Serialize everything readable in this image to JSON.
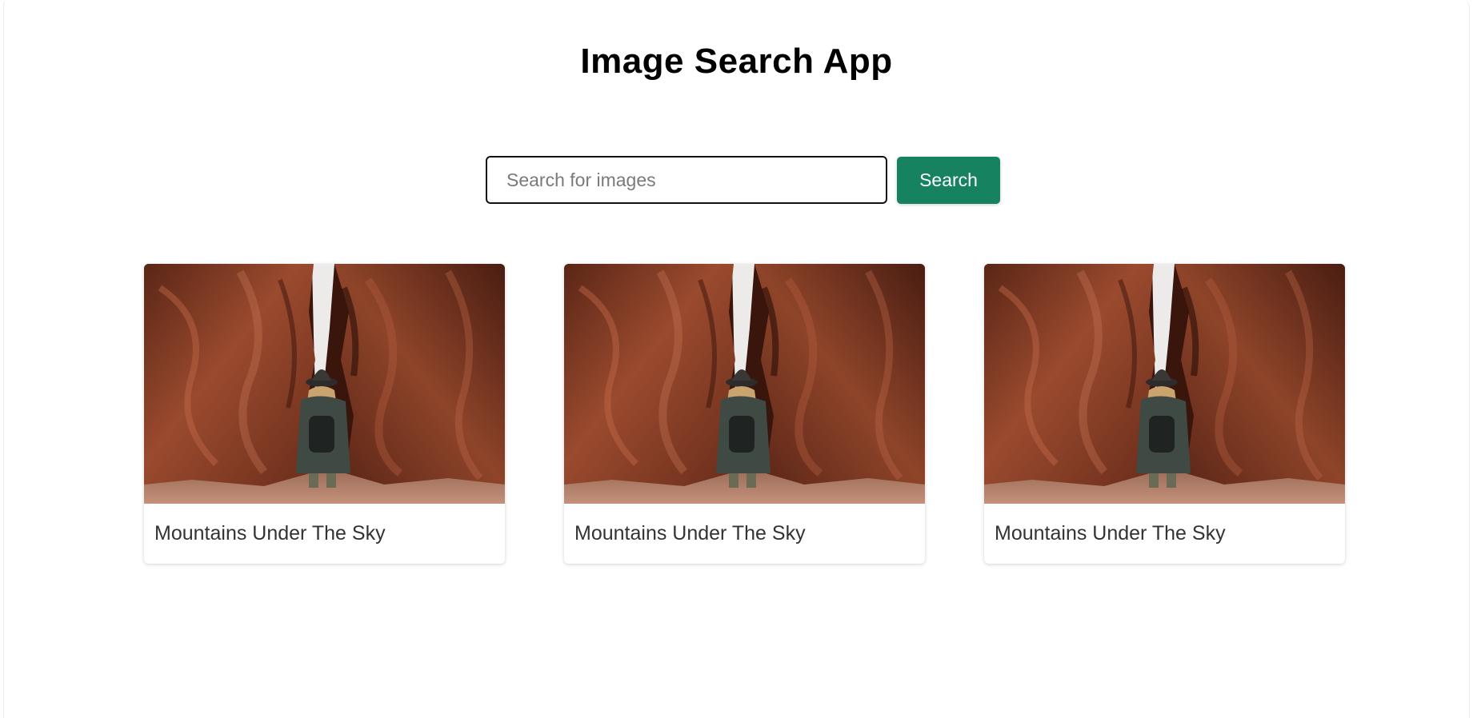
{
  "app": {
    "title": "Image Search App"
  },
  "search": {
    "value": "",
    "placeholder": "Search for images",
    "button_label": "Search"
  },
  "results": [
    {
      "caption": "Mountains Under The Sky",
      "image": "canyon-hiker-photo"
    },
    {
      "caption": "Mountains Under The Sky",
      "image": "canyon-hiker-photo"
    },
    {
      "caption": "Mountains Under The Sky",
      "image": "canyon-hiker-photo"
    }
  ],
  "colors": {
    "accent": "#17825f",
    "title": "#000000",
    "caption": "#333333"
  }
}
